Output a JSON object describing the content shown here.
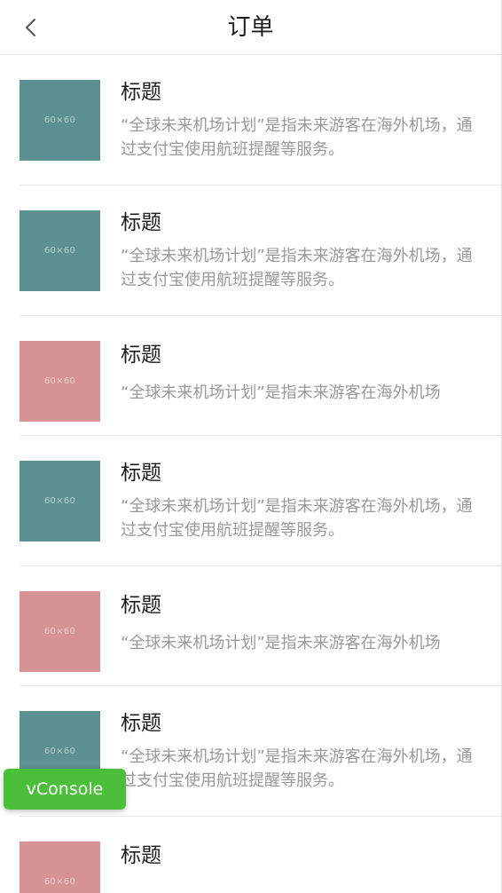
{
  "navbar": {
    "title": "订单",
    "back_icon": "chevron-left-icon"
  },
  "placeholder_label": "60×60",
  "colors": {
    "thumb_teal": "#5d9090",
    "thumb_pink": "#d69395",
    "vconsole_green": "#4cbf3a"
  },
  "items": [
    {
      "title": "标题",
      "desc": "“全球未来机场计划”是指未来游客在海外机场，通过支付宝使用航班提醒等服务。",
      "thumb": "teal"
    },
    {
      "title": "标题",
      "desc": "“全球未来机场计划”是指未来游客在海外机场，通过支付宝使用航班提醒等服务。",
      "thumb": "teal"
    },
    {
      "title": "标题",
      "desc": "“全球未来机场计划”是指未来游客在海外机场",
      "thumb": "pink"
    },
    {
      "title": "标题",
      "desc": "“全球未来机场计划”是指未来游客在海外机场，通过支付宝使用航班提醒等服务。",
      "thumb": "teal"
    },
    {
      "title": "标题",
      "desc": "“全球未来机场计划”是指未来游客在海外机场",
      "thumb": "pink"
    },
    {
      "title": "标题",
      "desc": "“全球未来机场计划”是指未来游客在海外机场，通过支付宝使用航班提醒等服务。",
      "thumb": "teal"
    },
    {
      "title": "标题",
      "desc": "",
      "thumb": "pink"
    }
  ],
  "vconsole": {
    "label": "vConsole"
  }
}
